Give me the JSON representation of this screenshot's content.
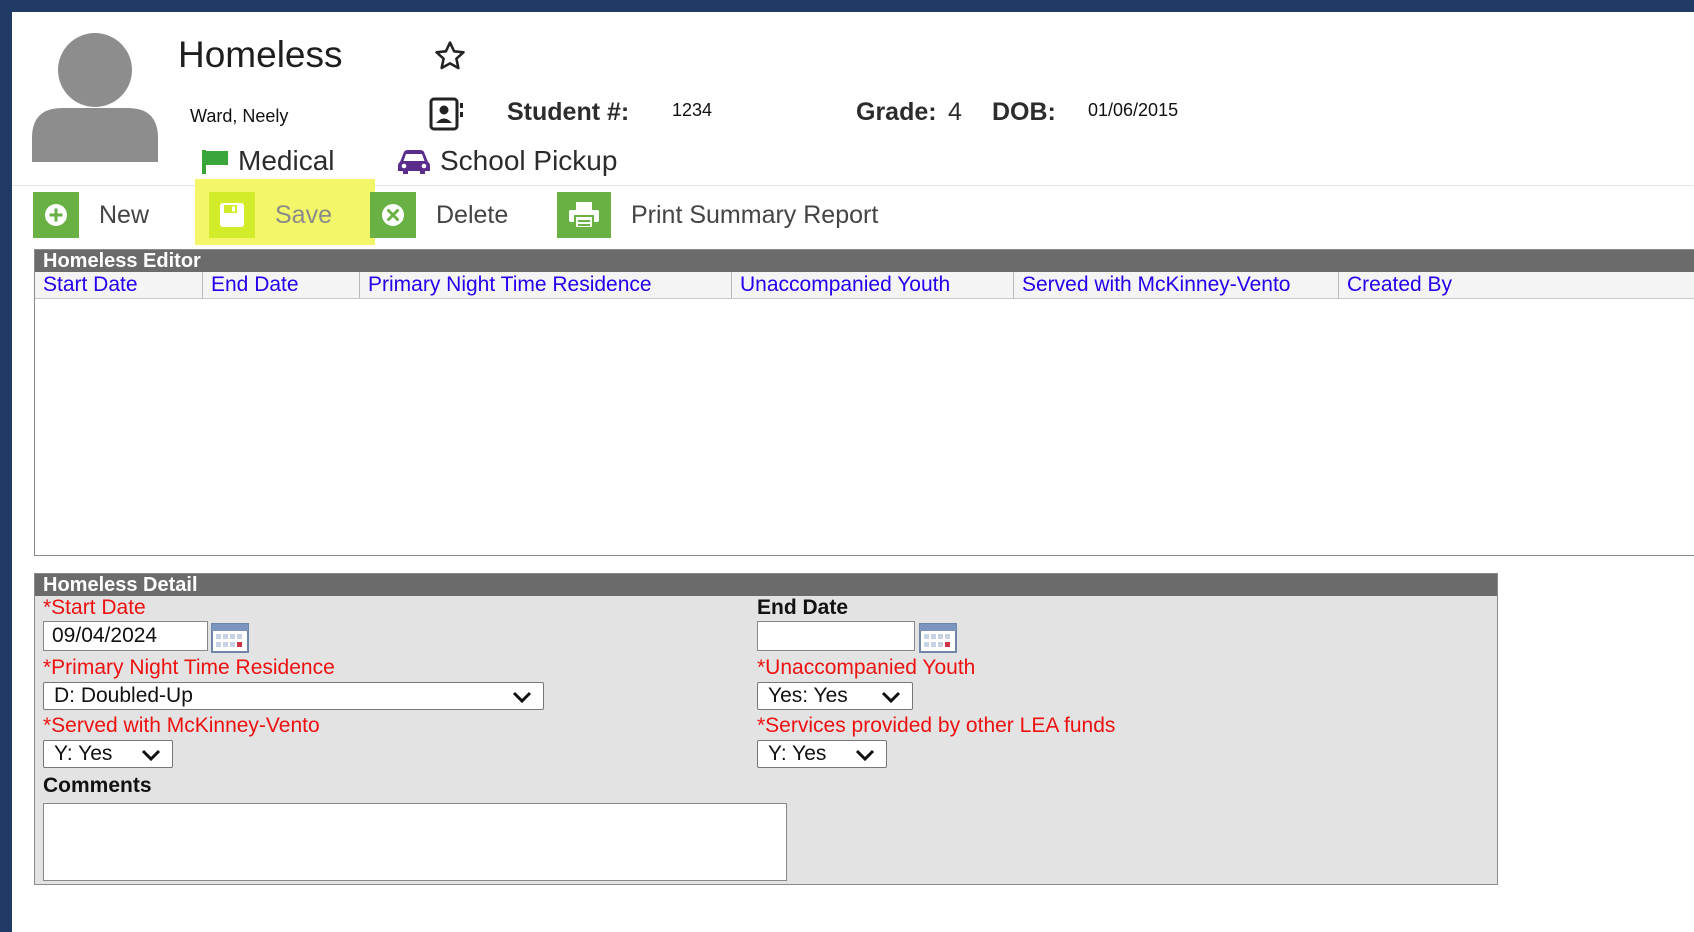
{
  "header": {
    "title": "Homeless",
    "student_name": "Ward, Neely",
    "student_num_label": "Student #:",
    "student_num": "1234",
    "grade_label": "Grade:",
    "grade": "4",
    "dob_label": "DOB:",
    "dob": "01/06/2015",
    "flags": [
      {
        "label": "Medical",
        "icon": "flag-icon",
        "color": "#3aa53a"
      },
      {
        "label": "School Pickup",
        "icon": "car-icon",
        "color": "#5a2d8c"
      }
    ]
  },
  "toolbar": {
    "new_label": "New",
    "save_label": "Save",
    "delete_label": "Delete",
    "print_label": "Print Summary Report",
    "accent_color": "#69b145",
    "highlight_color": "#f4f66a"
  },
  "editor": {
    "title": "Homeless Editor",
    "columns": [
      "Start Date",
      "End Date",
      "Primary Night Time Residence",
      "Unaccompanied Youth",
      "Served with McKinney-Vento",
      "Created By"
    ],
    "rows": []
  },
  "detail": {
    "title": "Homeless Detail",
    "start_date_label": "*Start Date",
    "start_date_value": "09/04/2024",
    "end_date_label": "End Date",
    "end_date_value": "",
    "residence_label": "*Primary Night Time Residence",
    "residence_value": "D: Doubled-Up",
    "unaccompanied_label": "*Unaccompanied Youth",
    "unaccompanied_value": "Yes: Yes",
    "mckinney_label": "*Served with McKinney-Vento",
    "mckinney_value": "Y: Yes",
    "lea_label": "*Services provided by other LEA funds",
    "lea_value": "Y: Yes",
    "comments_label": "Comments",
    "comments_value": ""
  }
}
